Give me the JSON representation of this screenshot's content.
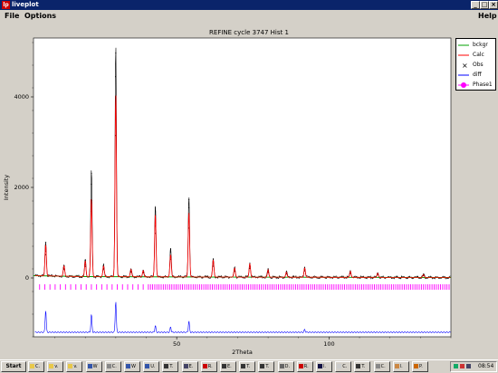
{
  "window": {
    "title": "liveplot",
    "min_label": "_",
    "max_label": "□",
    "close_label": "×"
  },
  "menu": {
    "file": "File",
    "options": "Options",
    "help": "Help"
  },
  "plot": {
    "title": "REFINE cycle 3747 Hist 1"
  },
  "chart_data": {
    "type": "line",
    "title": "REFINE cycle 3747 Hist 1",
    "xlabel": "2Theta",
    "ylabel": "Intensity",
    "xlim": [
      3,
      140
    ],
    "ylim": [
      -1300,
      5300
    ],
    "xticks": [
      50,
      100
    ],
    "yticks": [
      0,
      2000,
      4000
    ],
    "grid": false,
    "legend_position": "right",
    "series": [
      {
        "name": "bckgr",
        "color": "#00a000",
        "values": [
          [
            3,
            50
          ],
          [
            20,
            30
          ],
          [
            60,
            20
          ],
          [
            100,
            15
          ],
          [
            140,
            10
          ]
        ]
      },
      {
        "name": "Calc",
        "color": "#ff0000",
        "peaks": [
          [
            7,
            700
          ],
          [
            13,
            230
          ],
          [
            20,
            350
          ],
          [
            22,
            1750
          ],
          [
            26,
            240
          ],
          [
            30,
            4100
          ],
          [
            35,
            160
          ],
          [
            39,
            140
          ],
          [
            43,
            1400
          ],
          [
            48,
            500
          ],
          [
            54,
            1450
          ],
          [
            62,
            380
          ],
          [
            69,
            200
          ],
          [
            74,
            300
          ],
          [
            80,
            160
          ],
          [
            86,
            110
          ],
          [
            92,
            210
          ],
          [
            107,
            130
          ],
          [
            116,
            90
          ],
          [
            131,
            60
          ]
        ]
      },
      {
        "name": "Obs",
        "color": "#000000",
        "peaks": [
          [
            7,
            780
          ],
          [
            13,
            250
          ],
          [
            20,
            380
          ],
          [
            22,
            2400
          ],
          [
            26,
            260
          ],
          [
            30,
            5200
          ],
          [
            35,
            170
          ],
          [
            39,
            150
          ],
          [
            43,
            1600
          ],
          [
            48,
            650
          ],
          [
            54,
            1800
          ],
          [
            62,
            400
          ],
          [
            69,
            210
          ],
          [
            74,
            320
          ],
          [
            80,
            170
          ],
          [
            86,
            120
          ],
          [
            92,
            230
          ],
          [
            107,
            140
          ],
          [
            116,
            100
          ],
          [
            131,
            70
          ]
        ]
      },
      {
        "name": "diff",
        "color": "#0000ff",
        "baseline": -1200,
        "peaks": [
          [
            7,
            500
          ],
          [
            22,
            400
          ],
          [
            30,
            700
          ],
          [
            43,
            150
          ],
          [
            48,
            120
          ],
          [
            54,
            250
          ],
          [
            92,
            60
          ]
        ]
      },
      {
        "name": "Phase1",
        "color": "#ff00ff",
        "tick_level": -200,
        "tick_start": 5,
        "tick_end": 140
      }
    ]
  },
  "taskbar": {
    "start": "Start",
    "items": [
      "C.",
      "v.",
      "v.",
      "W",
      "C.",
      "W",
      "U.",
      "T.",
      "E.",
      "R.",
      "E.",
      "T.",
      "T.",
      "D.",
      "R.",
      "l.",
      "C.",
      "T.",
      "C.",
      "l.",
      "P."
    ],
    "clock": "08:54"
  },
  "colors": {
    "accent_title": "#0a246a",
    "face": "#d4d0c8"
  },
  "icons": {
    "app": "liveplot-app-icon",
    "start": "windows-logo-icon"
  }
}
